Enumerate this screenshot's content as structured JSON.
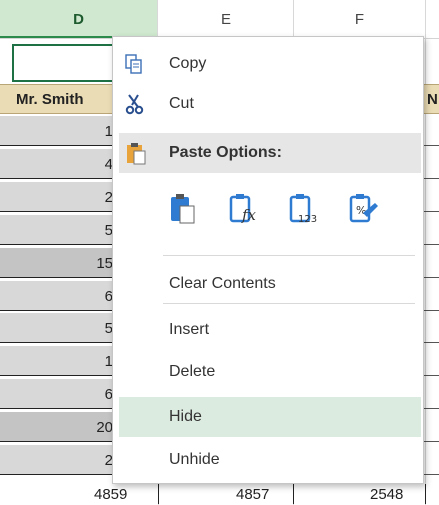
{
  "columns": [
    "D",
    "E",
    "F"
  ],
  "header_row": {
    "d": "Mr. Smith",
    "g": "N"
  },
  "rows": [
    {
      "value": "1"
    },
    {
      "value": "4"
    },
    {
      "value": "2"
    },
    {
      "value": "5"
    },
    {
      "value": "15",
      "sum": true
    },
    {
      "value": "6"
    },
    {
      "value": "5"
    },
    {
      "value": "1"
    },
    {
      "value": "6"
    },
    {
      "value": "20",
      "sum": true
    },
    {
      "value": "2"
    }
  ],
  "bottom_row": [
    "4859",
    "4857",
    "2548"
  ],
  "menu": {
    "copy": "Copy",
    "cut": "Cut",
    "paste_options": "Paste Options:",
    "paste_icons": [
      "paste-icon",
      "paste-formulas-icon",
      "paste-values-icon",
      "paste-formatting-icon"
    ],
    "clear_contents": "Clear Contents",
    "insert": "Insert",
    "delete": "Delete",
    "hide": "Hide",
    "unhide": "Unhide"
  },
  "colors": {
    "selected_header": "#cfe8cf",
    "selection_border": "#1e7145",
    "header_fill": "#eadcb4",
    "hover_item": "#dcebe0",
    "paste_header": "#e6e6e6"
  }
}
